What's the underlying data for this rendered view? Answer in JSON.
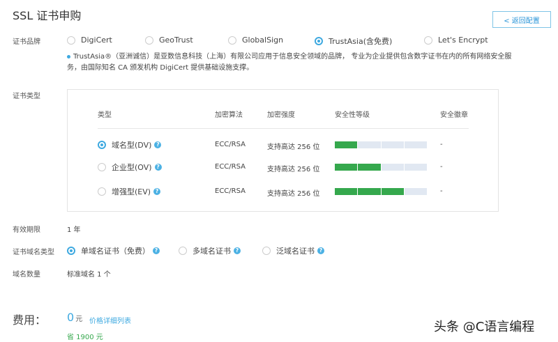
{
  "title": "SSL 证书申购",
  "back_button": "< 返回配置",
  "brand": {
    "label": "证书品牌",
    "options": [
      "DigiCert",
      "GeoTrust",
      "GlobalSign",
      "TrustAsia(含免费)",
      "Let's Encrypt"
    ],
    "selected": 3,
    "description_line1": "TrustAsia®（亚洲诚信）是亚数信息科技（上海）有限公司应用于信息安全领域的品牌， 专业为企业提供包含数字证书在内的所有网络安全服",
    "description_line2": "务，由国际知名 CA 颁发机构 DigiCert 提供基础设施支撑。"
  },
  "cert_type": {
    "label": "证书类型",
    "headers": [
      "类型",
      "加密算法",
      "加密强度",
      "安全性等级",
      "安全徽章"
    ],
    "rows": [
      {
        "type": "域名型(DV)",
        "algo": "ECC/RSA",
        "strength": "支持高达 256 位",
        "level": 1,
        "level_max": 4,
        "badge": "-",
        "selected": true
      },
      {
        "type": "企业型(OV)",
        "algo": "ECC/RSA",
        "strength": "支持高达 256 位",
        "level": 2,
        "level_max": 4,
        "badge": "-",
        "selected": false
      },
      {
        "type": "增强型(EV)",
        "algo": "ECC/RSA",
        "strength": "支持高达 256 位",
        "level": 3,
        "level_max": 4,
        "badge": "-",
        "selected": false
      }
    ]
  },
  "validity": {
    "label": "有效期限",
    "value": "1 年"
  },
  "domain_type": {
    "label": "证书域名类型",
    "options": [
      "单域名证书（免费）",
      "多域名证书",
      "泛域名证书"
    ],
    "selected": 0
  },
  "domain_count": {
    "label": "域名数量",
    "value": "标准域名 1 个"
  },
  "fee": {
    "label": "费用：",
    "amount": "0",
    "unit": "元",
    "price_link": "价格详细列表",
    "saving": "省 1900 元"
  },
  "watermark": "头条 @C语言编程"
}
